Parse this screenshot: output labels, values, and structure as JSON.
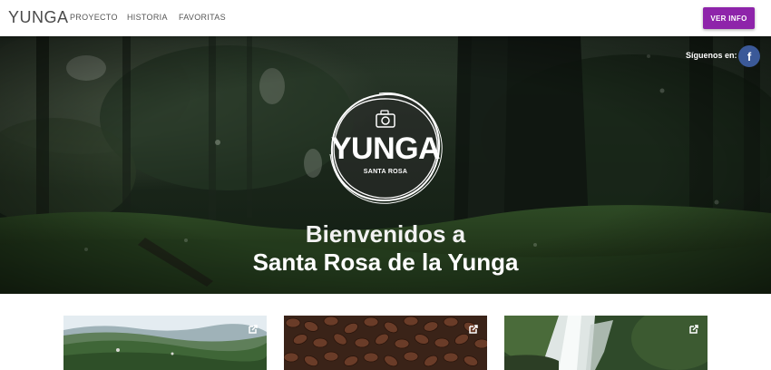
{
  "nav": {
    "brand": "YUNGA",
    "links": [
      "PROYECTO",
      "HISTORIA",
      "FAVORITAS"
    ],
    "cta": "VER INFO"
  },
  "hero": {
    "social_label": "Síguenos en:",
    "facebook_glyph": "f",
    "logo_title": "YUNGA",
    "logo_subtitle": "SANTA ROSA",
    "headline_line1": "Bienvenidos a",
    "headline_line2": "Santa Rosa de la Yunga"
  },
  "cards": [
    {
      "image": "mountain-landscape",
      "icon": "external-link-icon"
    },
    {
      "image": "coffee-beans",
      "icon": "external-link-icon"
    },
    {
      "image": "waterfall",
      "icon": "external-link-icon"
    }
  ],
  "colors": {
    "accent": "#8e24aa",
    "facebook": "#3b5998",
    "nav_bg": "#ffffff",
    "hero_dark": "#0e1710"
  }
}
